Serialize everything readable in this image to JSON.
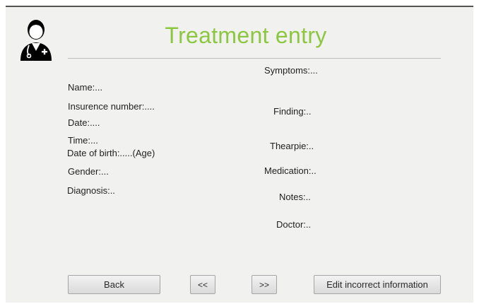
{
  "header": {
    "title": "Treatment entry",
    "icon": "doctor-avatar-icon"
  },
  "left_fields": {
    "name": "Name:...",
    "insurance": "Insurence number:....",
    "date": "Date:....",
    "time": "Time:...",
    "dob": "Date of birth:.....(Age)",
    "gender": "Gender:...",
    "diagnosis": "Diagnosis:.."
  },
  "right_fields": {
    "symptoms": "Symptoms:...",
    "finding": "Finding:..",
    "therapy": "Thearpie:..",
    "medication": "Medication:..",
    "notes": "Notes:..",
    "doctor": "Doctor:.."
  },
  "buttons": {
    "back": "Back",
    "prev": "<<",
    "next": ">>",
    "edit": "Edit incorrect information"
  },
  "colors": {
    "title": "#8dc63f",
    "window_bg": "#f1f1f0",
    "avatar": "#000000"
  }
}
